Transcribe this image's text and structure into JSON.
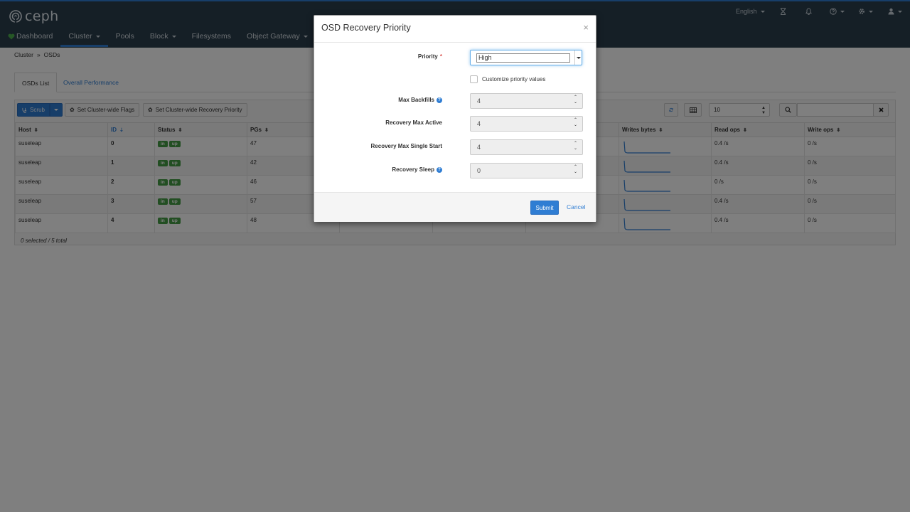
{
  "brand": {
    "name": "ceph"
  },
  "utility": {
    "language": "English",
    "icons": [
      "hourglass-icon",
      "bell-icon",
      "question-icon",
      "gear-icon",
      "user-icon"
    ]
  },
  "nav": {
    "dashboard": "Dashboard",
    "cluster": "Cluster",
    "pools": "Pools",
    "block": "Block",
    "filesystems": "Filesystems",
    "object_gateway": "Object Gateway"
  },
  "breadcrumb": {
    "parent": "Cluster",
    "separator": "»",
    "current": "OSDs"
  },
  "tabs": {
    "list": "OSDs List",
    "performance": "Overall Performance"
  },
  "toolbar": {
    "scrub": "Scrub",
    "flags": "Set Cluster-wide Flags",
    "recovery": "Set Cluster-wide Recovery Priority",
    "page_size": "10"
  },
  "table": {
    "headers": {
      "host": "Host",
      "id": "ID",
      "status": "Status",
      "pgs": "PGs",
      "writes_bytes": "Writes bytes",
      "read_ops": "Read ops",
      "write_ops": "Write ops"
    },
    "rows": [
      {
        "host": "suseleap",
        "id": "0",
        "status_in": "in",
        "status_up": "up",
        "pgs": "47",
        "read_ops": "0.4 /s",
        "write_ops": "0 /s"
      },
      {
        "host": "suseleap",
        "id": "1",
        "status_in": "in",
        "status_up": "up",
        "pgs": "42",
        "read_ops": "0.4 /s",
        "write_ops": "0 /s"
      },
      {
        "host": "suseleap",
        "id": "2",
        "status_in": "in",
        "status_up": "up",
        "pgs": "46",
        "read_ops": "0 /s",
        "write_ops": "0 /s"
      },
      {
        "host": "suseleap",
        "id": "3",
        "status_in": "in",
        "status_up": "up",
        "pgs": "57",
        "read_ops": "0.4 /s",
        "write_ops": "0 /s"
      },
      {
        "host": "suseleap",
        "id": "4",
        "status_in": "in",
        "status_up": "up",
        "pgs": "48",
        "read_ops": "0.4 /s",
        "write_ops": "0 /s"
      }
    ],
    "footer": "0 selected / 5 total"
  },
  "modal": {
    "title": "OSD Recovery Priority",
    "close": "×",
    "priority_label": "Priority",
    "required_mark": "*",
    "priority_value": "High",
    "customize_label": "Customize priority values",
    "max_backfills_label": "Max Backfills",
    "max_backfills_value": "4",
    "recovery_max_active_label": "Recovery Max Active",
    "recovery_max_active_value": "4",
    "recovery_max_single_start_label": "Recovery Max Single Start",
    "recovery_max_single_start_value": "4",
    "recovery_sleep_label": "Recovery Sleep",
    "recovery_sleep_value": "0",
    "submit": "Submit",
    "cancel": "Cancel"
  },
  "colors": {
    "navbar": "#2b3e4d",
    "accent": "#2f7dd3",
    "status_green": "#449d44",
    "dashboard_heart": "#4cae4c"
  }
}
